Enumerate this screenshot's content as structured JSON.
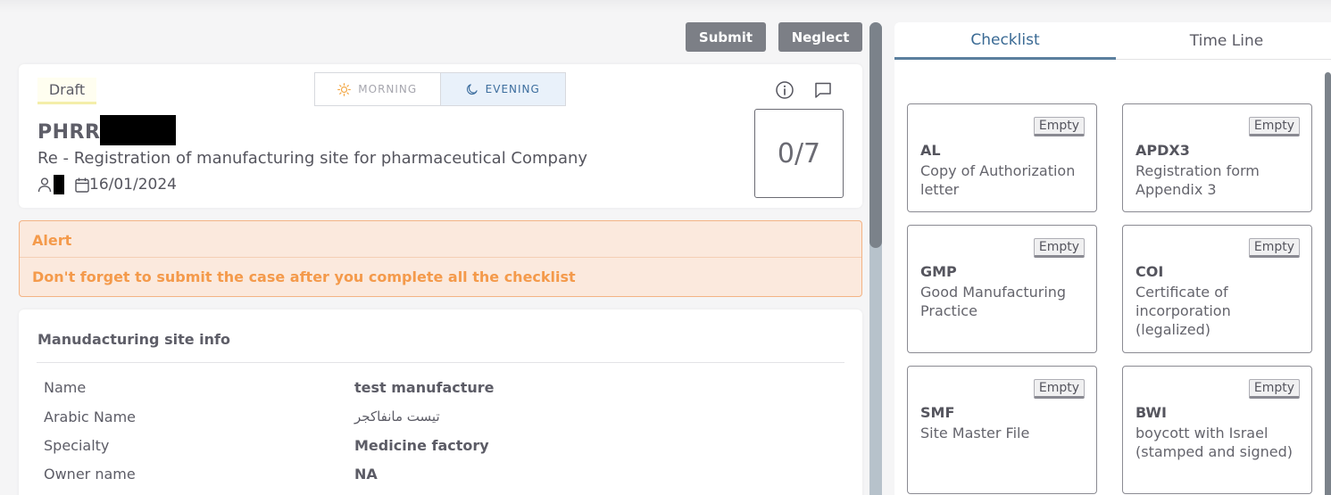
{
  "toolbar": {
    "submit_label": "Submit",
    "neglect_label": "Neglect"
  },
  "case": {
    "status": "Draft",
    "code_prefix": "PHRR-",
    "title": "Re - Registration of manufacturing site for pharmaceutical Company",
    "date": "16/01/2024",
    "progress": "0/7",
    "shift": {
      "morning_label": "MORNING",
      "evening_label": "EVENING",
      "selected": "EVENING"
    }
  },
  "alert": {
    "title": "Alert",
    "message": "Don't forget to submit the case after you complete all the checklist"
  },
  "site_info": {
    "heading": "Manudacturing site info",
    "rows": [
      {
        "label": "Name",
        "value": "test manufacture"
      },
      {
        "label": "Arabic Name",
        "value": "تيست مانفاكجر"
      },
      {
        "label": "Specialty",
        "value": "Medicine factory"
      },
      {
        "label": "Owner name",
        "value": "NA"
      }
    ]
  },
  "tabs": [
    {
      "label": "Checklist",
      "active": true
    },
    {
      "label": "Time Line",
      "active": false
    }
  ],
  "checklist": [
    {
      "code": "AL",
      "desc": "Copy of Authorization letter",
      "status": "Empty"
    },
    {
      "code": "APDX3",
      "desc": "Registration form Appendix 3",
      "status": "Empty"
    },
    {
      "code": "GMP",
      "desc": "Good Manufacturing Practice",
      "status": "Empty"
    },
    {
      "code": "COI",
      "desc": "Certificate of incorporation (legalized)",
      "status": "Empty"
    },
    {
      "code": "SMF",
      "desc": "Site Master File",
      "status": "Empty"
    },
    {
      "code": "BWI",
      "desc": "boycott with Israel (stamped and signed)",
      "status": "Empty"
    }
  ],
  "colors": {
    "button_bg": "#7c7f86",
    "alert_bg": "#fbe9dd",
    "alert_text": "#f49a4b",
    "tab_active": "#3a6a94",
    "evening_bg": "#e9f1fa"
  }
}
